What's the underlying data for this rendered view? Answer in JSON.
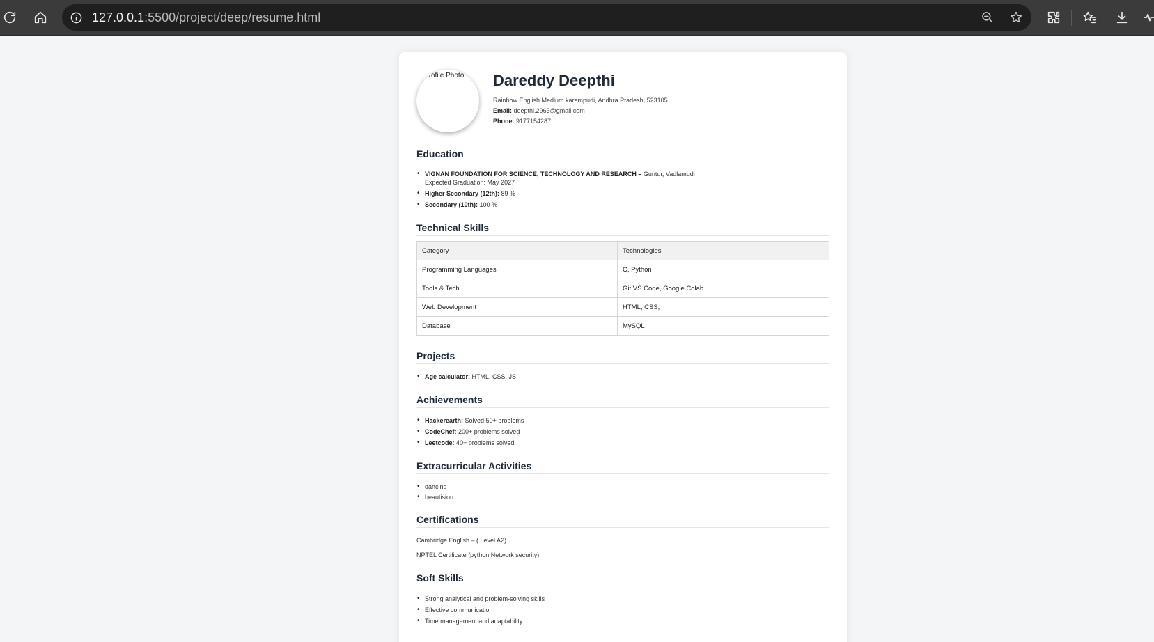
{
  "browser": {
    "url_host": "127.0.0.1",
    "url_path": ":5500/project/deep/resume.html"
  },
  "resume": {
    "photo_alt": "Profile Photo",
    "name": "Dareddy Deepthi",
    "address": "Rainbow English Medium karempudi, Andhra Pradesh, 523105",
    "email_label": "Email:",
    "email": "deepthi.2963@gmail.com",
    "phone_label": "Phone:",
    "phone": "9177154287",
    "education": {
      "title": "Education",
      "items": [
        {
          "label": "VIGNAN FOUNDATION FOR SCIENCE, TECHNOLOGY AND RESEARCH –",
          "text": "Guntur, Vadlamudi",
          "sub": "Expected Graduation: May 2027"
        },
        {
          "label": "Higher Secondary (12th):",
          "text": "89 %"
        },
        {
          "label": "Secondary (10th):",
          "text": "100 %"
        }
      ]
    },
    "skills": {
      "title": "Technical Skills",
      "headers": [
        "Category",
        "Technologies"
      ],
      "rows": [
        [
          "Programming Languages",
          "C, Python"
        ],
        [
          "Tools & Tech",
          "Git,VS Code, Google Colab"
        ],
        [
          "Web Development",
          "HTML, CSS,"
        ],
        [
          "Database",
          "MySQL"
        ]
      ]
    },
    "projects": {
      "title": "Projects",
      "items": [
        {
          "label": "Age calculator:",
          "text": "HTML, CSS, JS"
        }
      ]
    },
    "achievements": {
      "title": "Achievements",
      "items": [
        {
          "label": "Hackerearth:",
          "text": "Solved 50+ problems"
        },
        {
          "label": "CodeChef:",
          "text": "200+ problems solved"
        },
        {
          "label": "Leetcode:",
          "text": "40+ problems solved"
        }
      ]
    },
    "extracurricular": {
      "title": "Extracurricular Activities",
      "items": [
        "dancing",
        "beautision"
      ]
    },
    "certifications": {
      "title": "Certifications",
      "items": [
        "Cambridge English – ( Level A2)",
        "NPTEL Certificate (python,Network security)"
      ]
    },
    "soft_skills": {
      "title": "Soft Skills",
      "items": [
        "Strong analytical and problem-solving skills",
        "Effective communication",
        "Time management and adaptability"
      ]
    }
  }
}
